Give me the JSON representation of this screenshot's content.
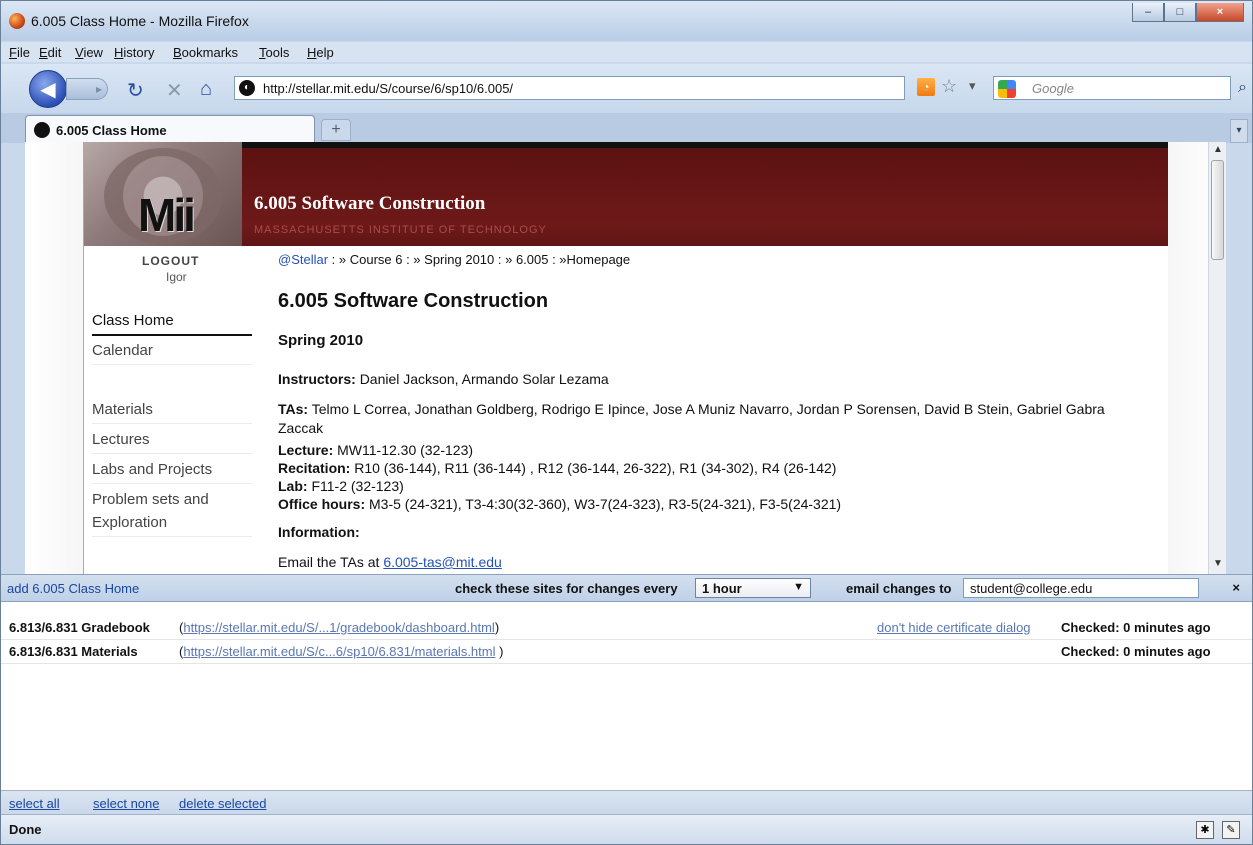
{
  "window": {
    "title": "6.005 Class Home - Mozilla Firefox",
    "controls": [
      "–",
      "□",
      "×"
    ]
  },
  "menu": [
    "File",
    "Edit",
    "View",
    "History",
    "Bookmarks",
    "Tools",
    "Help"
  ],
  "nav": {
    "back_icon": "back-arrow-icon",
    "forward_icon": "forward-arrow-icon",
    "reload_icon": "reload-icon",
    "stop_icon": "stop-icon",
    "home_icon": "home-icon",
    "url": "http://stellar.mit.edu/S/course/6/sp10/6.005/",
    "search_placeholder": "Google"
  },
  "tab": {
    "title": "6.005 Class Home"
  },
  "page": {
    "banner_title": "6.005  Software Construction",
    "banner_subtitle": "MASSACHUSETTS INSTITUTE OF TECHNOLOGY",
    "logout": "LOGOUT",
    "user": "Igor",
    "sidebar": [
      {
        "label": "Class Home",
        "active": true
      },
      {
        "label": "Calendar",
        "active": false
      },
      {
        "label": "Materials",
        "active": false
      },
      {
        "label": "Lectures",
        "active": false
      },
      {
        "label": "Labs and Projects",
        "active": false
      },
      {
        "label": "Problem sets and",
        "active": false
      },
      {
        "label": "Exploration",
        "active": false
      }
    ],
    "breadcrumb": {
      "part1": "@Stellar",
      "part2": " : » Course 6 : » Spring 2010 : » 6.005 : »Homepage"
    },
    "course_title": "6.005  Software Construction",
    "semester": "Spring 2010",
    "instructors_label": "Instructors:",
    "instructors": "Daniel Jackson, Armando Solar Lezama",
    "tas_label": "TAs:",
    "tas": "Telmo L Correa, Jonathan Goldberg, Rodrigo E Ipince, Jose A Muniz Navarro, Jordan P Sorensen, David B Stein, Gabriel Gabra Zaccak",
    "lecture_label": "Lecture:",
    "lecture": "MW11-12.30  (32-123)",
    "recitation_label": "Recitation:",
    "recitation": "R10 (36-144), R11 (36-144) , R12 (36-144, 26-322), R1 (34-302), R4 (26-142)",
    "lab_label": "Lab:",
    "lab": "F11-2  (32-123)",
    "office_label": "Office hours:",
    "office": "M3-5 (24-321), T3-4:30(32-360), W3-7(24-323), R3-5(24-321), F3-5(24-321)",
    "information_label": "Information:",
    "email_prefix": "Email the TAs at ",
    "email": "6.005-tas@mit.edu"
  },
  "addon": {
    "add_text": "add 6.005 Class Home",
    "check_label": "check these sites for changes every",
    "frequency": "1 hour",
    "email_label": "email changes to",
    "email_value": "student@college.edu",
    "close": "×",
    "sites": [
      {
        "name": "6.813/6.831 Gradebook",
        "url": "https://stellar.mit.edu/S/...1/gradebook/dashboard.html",
        "extra_link": "don't hide certificate dialog",
        "checked": "Checked: 0 minutes ago"
      },
      {
        "name": "6.813/6.831 Materials",
        "url": "https://stellar.mit.edu/S/c...6/sp10/6.831/materials.html",
        "extra_link": "",
        "checked": "Checked: 0 minutes ago"
      }
    ],
    "actions": [
      "select all",
      "select none",
      "delete selected"
    ]
  },
  "status": {
    "text": "Done"
  },
  "colors": {
    "banner": "#6e1919",
    "link": "#2451b8",
    "chrome": "#c9d8ea"
  }
}
